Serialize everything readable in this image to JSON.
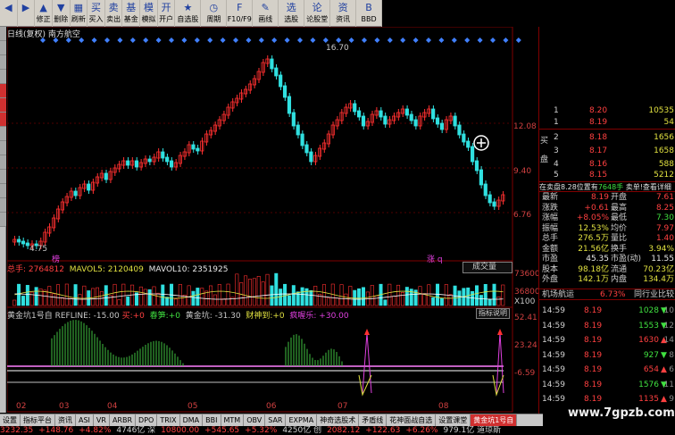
{
  "toolbar": [
    {
      "icon": "left-arrow-icon",
      "glyph": "◀",
      "label": ""
    },
    {
      "icon": "right-arrow-icon",
      "glyph": "▶",
      "label": ""
    },
    {
      "icon": "up-arrow-icon",
      "glyph": "▲",
      "label": "修正"
    },
    {
      "icon": "down-arrow-icon",
      "glyph": "▼",
      "label": "删除"
    },
    {
      "icon": "layout-icon",
      "glyph": "▦",
      "label": "刷新"
    },
    {
      "icon": "buy-icon",
      "glyph": "买",
      "label": "买入"
    },
    {
      "icon": "sell-icon",
      "glyph": "卖",
      "label": "卖出"
    },
    {
      "icon": "fund-icon",
      "glyph": "基",
      "label": "基金"
    },
    {
      "icon": "simulate-icon",
      "glyph": "模",
      "label": "模拟"
    },
    {
      "icon": "account-icon",
      "glyph": "开",
      "label": "开户"
    },
    {
      "icon": "watchlist-icon",
      "glyph": "★",
      "label": "自选股"
    },
    {
      "icon": "cycle-icon",
      "glyph": "◷",
      "label": "周期"
    },
    {
      "icon": "f10-icon",
      "glyph": "F",
      "label": "F10/F9"
    },
    {
      "icon": "drawline-icon",
      "glyph": "✎",
      "label": "画线"
    },
    {
      "icon": "select-stock-icon",
      "glyph": "选",
      "label": "选股"
    },
    {
      "icon": "forum-icon",
      "glyph": "论",
      "label": "论股堂"
    },
    {
      "icon": "news-icon",
      "glyph": "资",
      "label": "资讯"
    },
    {
      "icon": "bbd-icon",
      "glyph": "B",
      "label": "BBD"
    }
  ],
  "chart_title": "日线(复权) 南方航空",
  "price_axis": [
    "12.08",
    "9.40",
    "6.76"
  ],
  "price_peak_label": "16.70",
  "price_low_label": "4.75",
  "marker_left": "榜",
  "marker_right": "涨 q",
  "volume_legend": {
    "total": "总手: 2764812",
    "mavol5": "MAVOL5: 2120409",
    "mavol10": "MAVOL10: 2351925",
    "dropdown": "成交量"
  },
  "volume_axis": [
    "73600",
    "36800",
    "X100"
  ],
  "indicator_legend": {
    "name": "黄金坑1号自 REFLINE: -15.00",
    "buy": "买:",
    "buy_val": "+0",
    "spring": "春笋:",
    "spring_val": "+0",
    "pit": "黄金坑: -31.30",
    "wealth": "财神到:",
    "wealth_val": "+0",
    "bull": "疯喔乐: +30.00",
    "help": "指标说明"
  },
  "indicator_axis": [
    "52.41",
    "23.24",
    "-6.59"
  ],
  "x_axis_labels": [
    "02",
    "03",
    "04",
    "05",
    "06",
    "07",
    "08"
  ],
  "orderbook": {
    "sell_side_label": "",
    "buy_side_label": "买盘",
    "rows": [
      {
        "lvl": "1",
        "price": "8.20",
        "vol": "10535"
      },
      {
        "lvl": "1",
        "price": "8.19",
        "vol": "54"
      },
      {
        "lvl": "2",
        "price": "8.18",
        "vol": "1656"
      },
      {
        "lvl": "3",
        "price": "8.17",
        "vol": "1658"
      },
      {
        "lvl": "4",
        "price": "8.16",
        "vol": "588"
      },
      {
        "lvl": "5",
        "price": "8.15",
        "vol": "5212"
      }
    ]
  },
  "buy_sell_bar": {
    "text": "在卖盘8.28位置有",
    "extra": "7648手",
    "tail": "卖单!查看详细"
  },
  "quote_info": [
    {
      "l": "最新",
      "v": "8.19",
      "l2": "开盘",
      "v2": "7.61",
      "c": "",
      "c2": ""
    },
    {
      "l": "涨跌",
      "v": "+0.61",
      "l2": "最高",
      "v2": "8.25",
      "c": "",
      "c2": ""
    },
    {
      "l": "涨幅",
      "v": "+8.05%",
      "l2": "最低",
      "v2": "7.30",
      "c": "",
      "c2": "g"
    },
    {
      "l": "振幅",
      "v": "12.53%",
      "l2": "均价",
      "v2": "7.97",
      "c": "y",
      "c2": ""
    },
    {
      "l": "总手",
      "v": "276.5万",
      "l2": "量比",
      "v2": "1.40",
      "c": "y",
      "c2": ""
    },
    {
      "l": "金额",
      "v": "21.56亿",
      "l2": "换手",
      "v2": "3.94%",
      "c": "y",
      "c2": "y"
    },
    {
      "l": "市盈",
      "v": "45.35",
      "l2": "市盈(动)",
      "v2": "11.55",
      "c": "w",
      "c2": "w"
    },
    {
      "l": "股本",
      "v": "98.18亿",
      "l2": "流通",
      "v2": "70.23亿",
      "c": "y",
      "c2": "y"
    },
    {
      "l": "外盘",
      "v": "142.1万",
      "l2": "内盘",
      "v2": "134.4万",
      "c": "y",
      "c2": "y"
    }
  ],
  "tick_header": {
    "sector": "机场航运",
    "pct": "6.73%",
    "compare": "同行业比较"
  },
  "ticks": [
    {
      "time": "14:59",
      "price": "8.19",
      "vol": "1028",
      "arrow": "▼",
      "dir": "down",
      "sub": "10"
    },
    {
      "time": "14:59",
      "price": "8.19",
      "vol": "1553",
      "arrow": "▼",
      "dir": "down",
      "sub": "12"
    },
    {
      "time": "14:59",
      "price": "8.19",
      "vol": "1630",
      "arrow": "▲",
      "dir": "up",
      "sub": "14"
    },
    {
      "time": "14:59",
      "price": "8.19",
      "vol": "927",
      "arrow": "▼",
      "dir": "down",
      "sub": "8"
    },
    {
      "time": "14:59",
      "price": "8.19",
      "vol": "654",
      "arrow": "▲",
      "dir": "up",
      "sub": "6"
    },
    {
      "time": "14:59",
      "price": "8.19",
      "vol": "1576",
      "arrow": "▼",
      "dir": "down",
      "sub": "11"
    },
    {
      "time": "14:59",
      "price": "8.19",
      "vol": "1135",
      "arrow": "▲",
      "dir": "up",
      "sub": "9"
    }
  ],
  "bottom_tabs": [
    "设置",
    "指标平台",
    "资讯",
    "ASI",
    "VR",
    "ARBR",
    "DPO",
    "TRIX",
    "DMA",
    "BBI",
    "MTM",
    "OBV",
    "SAR",
    "EXPMA",
    "神奇选股术",
    "矛盾线",
    "花神面战自选",
    "设置课堂",
    "黄金坑1号自"
  ],
  "active_tab_index": 18,
  "ticker": [
    {
      "t": "3232.35",
      "c": "r"
    },
    {
      "t": "+148.76",
      "c": "r"
    },
    {
      "t": "+4.82%",
      "c": "r"
    },
    {
      "t": "4746亿 深",
      "c": "w"
    },
    {
      "t": "10800.00",
      "c": "r"
    },
    {
      "t": "+545.65",
      "c": "r"
    },
    {
      "t": "+5.32%",
      "c": "r"
    },
    {
      "t": "4250亿 创",
      "c": "w"
    },
    {
      "t": "2082.12",
      "c": "r"
    },
    {
      "t": "+122.63",
      "c": "r"
    },
    {
      "t": "+6.26%",
      "c": "r"
    },
    {
      "t": "979.1亿 道琼斯",
      "c": "w"
    }
  ],
  "watermark": "www.7gpzb.com"
}
